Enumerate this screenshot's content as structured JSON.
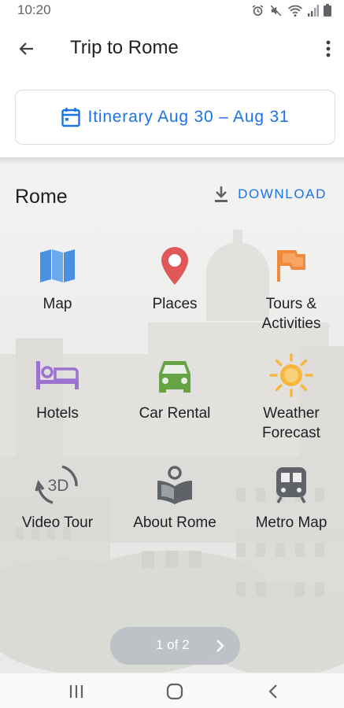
{
  "status_bar": {
    "time": "10:20",
    "icons": [
      "alarm-icon",
      "mute-icon",
      "wifi-icon",
      "signal-icon",
      "battery-icon"
    ]
  },
  "app_bar": {
    "title": "Trip to Rome",
    "back_icon": "arrow-back-icon",
    "more_icon": "more-vert-icon"
  },
  "itinerary": {
    "label": "Itinerary Aug 30 – Aug 31",
    "icon": "calendar-icon"
  },
  "destination": {
    "name": "Rome",
    "download_label": "DOWNLOAD",
    "download_icon": "download-icon"
  },
  "tiles": [
    {
      "label": "Map",
      "icon": "map-icon",
      "color": "#4a90e2"
    },
    {
      "label": "Places",
      "icon": "place-pin-icon",
      "color": "#e05757"
    },
    {
      "label": "Tours &\nActivities",
      "icon": "flag-icon",
      "color": "#f08a3c"
    },
    {
      "label": "Hotels",
      "icon": "hotel-bed-icon",
      "color": "#9b72cf"
    },
    {
      "label": "Car Rental",
      "icon": "car-icon",
      "color": "#66a344"
    },
    {
      "label": "Weather\nForecast",
      "icon": "sun-icon",
      "color": "#f6b73c"
    },
    {
      "label": "Video Tour",
      "icon": "3d-rotate-icon",
      "color": "#5f6368"
    },
    {
      "label": "About Rome",
      "icon": "book-info-icon",
      "color": "#5f6368"
    },
    {
      "label": "Metro Map",
      "icon": "train-icon",
      "color": "#5f6368"
    }
  ],
  "pager": {
    "label": "1 of 2",
    "next_icon": "chevron-right-icon"
  },
  "nav_bar": {
    "icons": [
      "recent-apps-icon",
      "home-icon",
      "back-nav-icon"
    ]
  }
}
